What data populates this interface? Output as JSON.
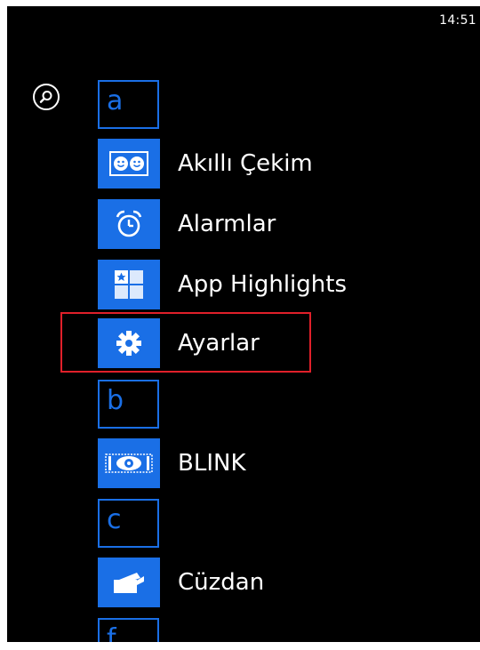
{
  "status_bar": {
    "time": "14:51"
  },
  "search": {
    "icon": "search-icon"
  },
  "app_list": {
    "accent_color": "#1a6fe6",
    "sections": [
      {
        "letter": "a"
      },
      {
        "letter": "b"
      },
      {
        "letter": "c"
      },
      {
        "letter": "f"
      }
    ],
    "apps": [
      {
        "name": "Akıllı Çekim",
        "icon": "smart-shoot-icon"
      },
      {
        "name": "Alarmlar",
        "icon": "alarm-clock-icon"
      },
      {
        "name": "App Highlights",
        "icon": "app-highlights-icon"
      },
      {
        "name": "Ayarlar",
        "icon": "gear-icon"
      },
      {
        "name": "BLINK",
        "icon": "eye-icon"
      },
      {
        "name": "Cüzdan",
        "icon": "wallet-icon"
      }
    ]
  },
  "annotation": {
    "highlight_color": "#e0202a",
    "highlighted_item": "Ayarlar"
  }
}
